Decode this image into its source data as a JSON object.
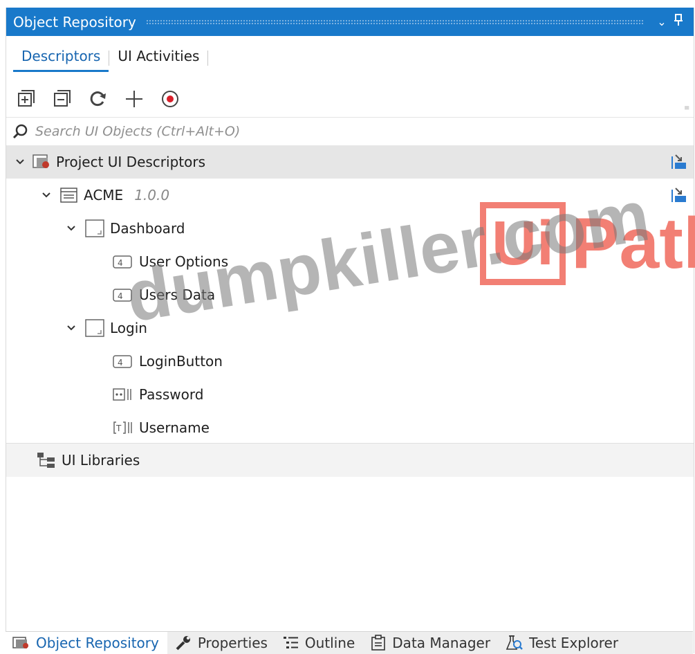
{
  "panel": {
    "title": "Object Repository"
  },
  "tabs": {
    "descriptors": "Descriptors",
    "ui_activities": "UI Activities"
  },
  "search": {
    "placeholder": "Search UI Objects (Ctrl+Alt+O)",
    "value": ""
  },
  "tree": {
    "project": "Project UI Descriptors",
    "app": {
      "name": "ACME",
      "version": "1.0.0"
    },
    "screens": [
      {
        "name": "Dashboard",
        "elements": [
          "User Options",
          "Users Data"
        ]
      },
      {
        "name": "Login",
        "elements": [
          "LoginButton",
          "Password",
          "Username"
        ]
      }
    ],
    "libraries": "UI Libraries"
  },
  "watermark": {
    "site": "dumpkiller.com",
    "logo_box": "Ui",
    "logo_rest": "Path"
  },
  "bottom_tabs": [
    "Object Repository",
    "Properties",
    "Outline",
    "Data Manager",
    "Test Explorer"
  ],
  "colors": {
    "accent": "#1979ca",
    "selected_row": "#e6e6e6",
    "watermark_logo": "#f27f74"
  }
}
